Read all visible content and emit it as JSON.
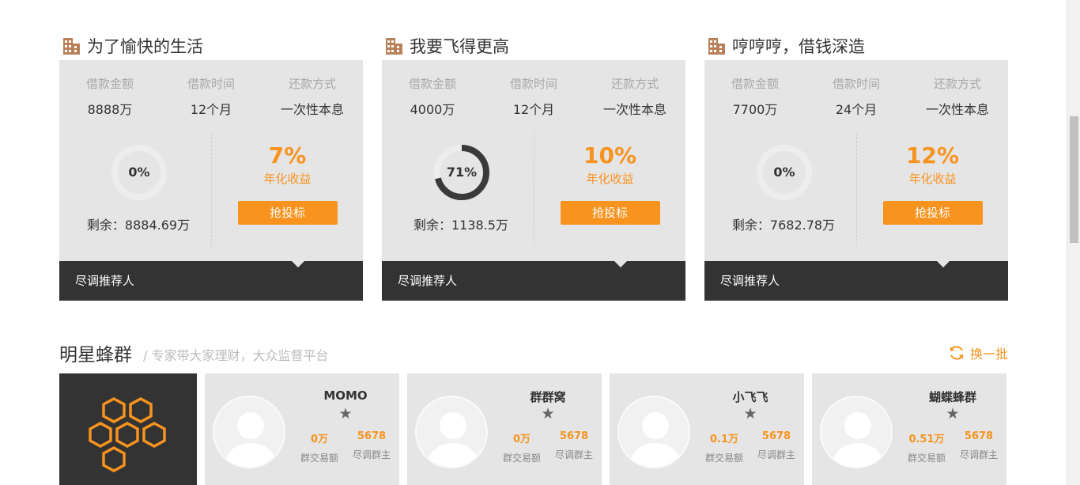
{
  "products": [
    {
      "title": "为了愉快的生活",
      "amount_label": "借款金额",
      "amount": "8888万",
      "term_label": "借款时间",
      "term": "12个月",
      "repay_label": "还款方式",
      "repay": "一次性本息",
      "progress": 0,
      "progress_text": "0%",
      "remain": "剩余：8884.69万",
      "rate": "7%",
      "rate_label": "年化收益",
      "button": "抢投标",
      "footer": "尽调推荐人"
    },
    {
      "title": "我要飞得更高",
      "amount_label": "借款金额",
      "amount": "4000万",
      "term_label": "借款时间",
      "term": "12个月",
      "repay_label": "还款方式",
      "repay": "一次性本息",
      "progress": 71,
      "progress_text": "71%",
      "remain": "剩余：1138.5万",
      "rate": "10%",
      "rate_label": "年化收益",
      "button": "抢投标",
      "footer": "尽调推荐人"
    },
    {
      "title": "哼哼哼，借钱深造",
      "amount_label": "借款金额",
      "amount": "7700万",
      "term_label": "借款时间",
      "term": "24个月",
      "repay_label": "还款方式",
      "repay": "一次性本息",
      "progress": 0,
      "progress_text": "0%",
      "remain": "剩余：7682.78万",
      "rate": "12%",
      "rate_label": "年化收益",
      "button": "抢投标",
      "footer": "尽调推荐人"
    }
  ],
  "section": {
    "title": "明星蜂群",
    "subtitle": "/ 专家带大家理财，大众监督平台",
    "refresh": "换一批"
  },
  "swarms": [
    {
      "name": "MOMO",
      "star": "★",
      "volume": "0万",
      "volume_label": "群交易额",
      "owner": "5678",
      "owner_label": "尽调群主"
    },
    {
      "name": "群群窝",
      "star": "★",
      "volume": "0万",
      "volume_label": "群交易额",
      "owner": "5678",
      "owner_label": "尽调群主"
    },
    {
      "name": "小飞飞",
      "star": "★",
      "volume": "0.1万",
      "volume_label": "群交易额",
      "owner": "5678",
      "owner_label": "尽调群主"
    },
    {
      "name": "蝴蝶蜂群",
      "star": "★",
      "volume": "0.51万",
      "volume_label": "群交易额",
      "owner": "5678",
      "owner_label": "尽调群主"
    }
  ],
  "colors": {
    "accent": "#f7931e",
    "card_bg": "#e5e5e5",
    "dark": "#333333"
  }
}
